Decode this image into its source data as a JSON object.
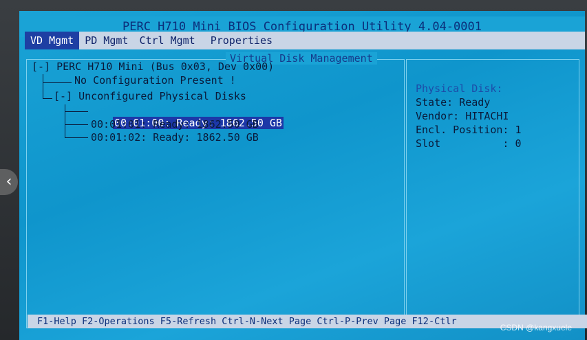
{
  "title": "PERC H710 Mini BIOS Configuration Utility 4.04-0001",
  "menu": {
    "vd_mgmt": "VD Mgmt",
    "pd_mgmt": "PD Mgmt",
    "ctrl_mgmt": "Ctrl Mgmt",
    "properties": "Properties"
  },
  "section_title": "Virtual Disk Management",
  "tree": {
    "controller": "[-] PERC H710 Mini (Bus 0x03, Dev 0x00)",
    "no_config": "No Configuration Present !",
    "unconfigured": "[-] Unconfigured Physical Disks",
    "disks": [
      "00:01:00: Ready: 1862.50 GB",
      "00:01:01: Ready: 1862.50 GB",
      "00:01:02: Ready: 1862.50 GB"
    ]
  },
  "side": {
    "heading": "Physical Disk:",
    "state": "State: Ready",
    "vendor": "Vendor: HITACHI",
    "encl_position": "Encl. Position: 1",
    "slot": "Slot          : 0"
  },
  "status_bar": "F1-Help F2-Operations F5-Refresh Ctrl-N-Next Page Ctrl-P-Prev Page F12-Ctlr",
  "watermark": "CSDN @kangxuele",
  "colors": {
    "screen_blue": "#1aa3d6",
    "menu_bar": "#c9d5e6",
    "highlight": "#1c38a8"
  }
}
